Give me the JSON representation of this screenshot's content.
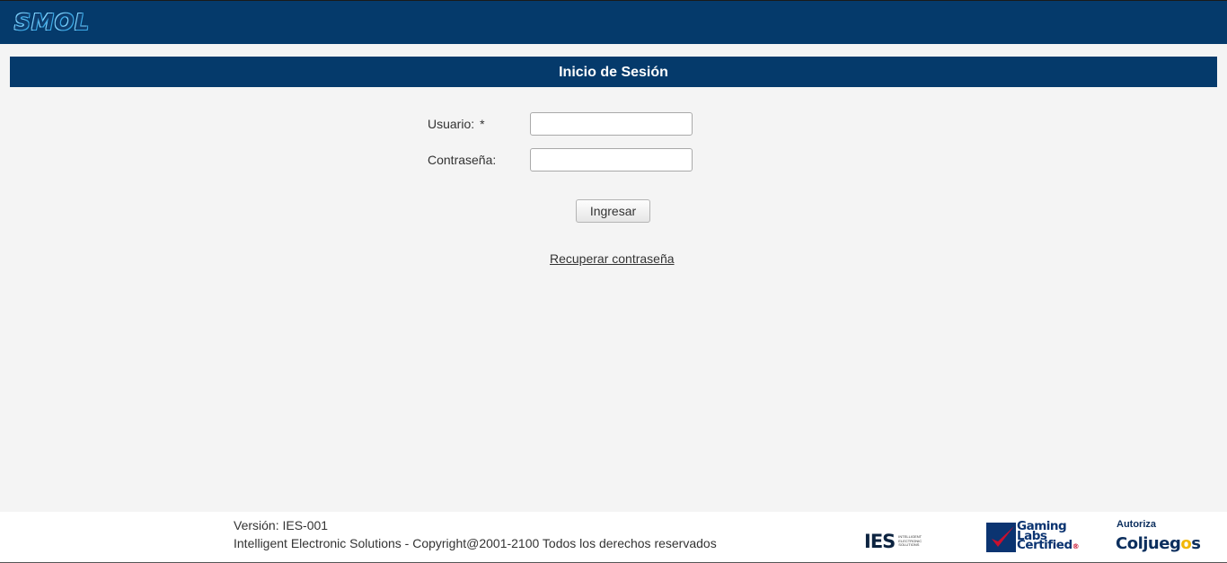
{
  "header": {
    "logo_text": "SMOL"
  },
  "login": {
    "title": "Inicio de Sesión",
    "username_label": "Usuario:",
    "required_mark": "*",
    "username_value": "",
    "password_label": "Contraseña:",
    "password_value": "",
    "submit_label": "Ingresar",
    "recover_link": "Recuperar contraseña"
  },
  "footer": {
    "version": "Versión: IES-001",
    "copyright": "Intelligent Electronic Solutions - Copyright@2001-2100 Todos los derechos reservados",
    "logos": {
      "ies_mark": "IES",
      "ies_sub": "INTELLIGENT ELECTRONIC SOLUTIONS",
      "glc_line1": "Gaming",
      "glc_line2": "Labs",
      "glc_line3": "Certified",
      "glc_reg": "®",
      "coljuegos_top": "Autoriza",
      "coljuegos_name_a": "Coljueg",
      "coljuegos_name_o": "o",
      "coljuegos_name_b": "s"
    }
  },
  "colors": {
    "brand_navy": "#053a6b",
    "page_bg": "#f4f4f4"
  }
}
